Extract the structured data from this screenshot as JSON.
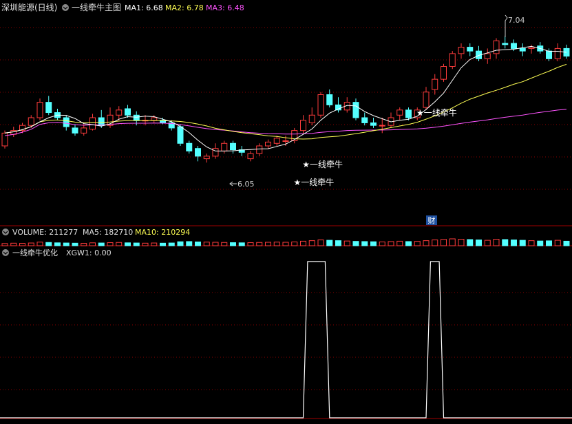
{
  "header": {
    "stock": "深圳能源(日线)",
    "indicator": "一线牵牛主图",
    "ma1": "MA1: 6.68",
    "ma2": "MA2: 6.78",
    "ma3": "MA3: 6.48"
  },
  "volume_header": {
    "volume": "VOLUME: 211277",
    "ma5": "MA5: 182710",
    "ma10": "MA10: 210294"
  },
  "sub_header": {
    "name": "一线牵牛优化",
    "xgw1": "XGW1: 0.00"
  },
  "labels": {
    "high": "7.04",
    "low": "6.05",
    "signal": "★一线牵牛",
    "cai": "财"
  },
  "colors": {
    "up": "#ff3c3c",
    "down": "#54ffff",
    "ma1": "#ffffff",
    "ma2": "#ffff54",
    "ma3": "#ff54ff",
    "grid": "#8b0000"
  },
  "chart_data": [
    {
      "type": "candlestick",
      "price_range": [
        5.6,
        7.2
      ],
      "candles": [
        [
          6.18,
          6.28,
          6.16,
          6.3
        ],
        [
          6.27,
          6.3,
          6.25,
          6.33
        ],
        [
          6.3,
          6.34,
          6.28,
          6.36
        ],
        [
          6.34,
          6.4,
          6.32,
          6.42
        ],
        [
          6.4,
          6.52,
          6.38,
          6.55
        ],
        [
          6.52,
          6.44,
          6.42,
          6.57
        ],
        [
          6.44,
          6.4,
          6.38,
          6.47
        ],
        [
          6.4,
          6.33,
          6.3,
          6.42
        ],
        [
          6.32,
          6.28,
          6.26,
          6.35
        ],
        [
          6.28,
          6.32,
          6.26,
          6.35
        ],
        [
          6.31,
          6.4,
          6.3,
          6.43
        ],
        [
          6.4,
          6.34,
          6.32,
          6.46
        ],
        [
          6.34,
          6.42,
          6.32,
          6.48
        ],
        [
          6.42,
          6.46,
          6.38,
          6.49
        ],
        [
          6.47,
          6.42,
          6.4,
          6.5
        ],
        [
          6.42,
          6.38,
          6.34,
          6.45
        ],
        [
          6.38,
          6.38,
          6.34,
          6.42
        ],
        [
          6.38,
          6.4,
          6.36,
          6.42
        ],
        [
          6.38,
          6.36,
          6.35,
          6.4
        ],
        [
          6.36,
          6.32,
          6.3,
          6.38
        ],
        [
          6.33,
          6.2,
          6.18,
          6.35
        ],
        [
          6.2,
          6.14,
          6.12,
          6.22
        ],
        [
          6.16,
          6.1,
          6.06,
          6.18
        ],
        [
          6.08,
          6.1,
          6.05,
          6.12
        ],
        [
          6.1,
          6.16,
          6.08,
          6.2
        ],
        [
          6.14,
          6.2,
          6.12,
          6.22
        ],
        [
          6.2,
          6.15,
          6.12,
          6.22
        ],
        [
          6.15,
          6.13,
          6.1,
          6.18
        ],
        [
          6.08,
          6.12,
          6.06,
          6.14
        ],
        [
          6.12,
          6.18,
          6.1,
          6.2
        ],
        [
          6.18,
          6.21,
          6.16,
          6.23
        ],
        [
          6.2,
          6.24,
          6.18,
          6.26
        ],
        [
          6.22,
          6.22,
          6.18,
          6.26
        ],
        [
          6.22,
          6.3,
          6.2,
          6.32
        ],
        [
          6.3,
          6.38,
          6.28,
          6.42
        ],
        [
          6.36,
          6.42,
          6.34,
          6.48
        ],
        [
          6.42,
          6.58,
          6.4,
          6.6
        ],
        [
          6.58,
          6.5,
          6.48,
          6.62
        ],
        [
          6.5,
          6.46,
          6.44,
          6.56
        ],
        [
          6.46,
          6.52,
          6.44,
          6.56
        ],
        [
          6.52,
          6.4,
          6.38,
          6.55
        ],
        [
          6.4,
          6.36,
          6.34,
          6.44
        ],
        [
          6.36,
          6.34,
          6.32,
          6.4
        ],
        [
          6.34,
          6.34,
          6.28,
          6.4
        ],
        [
          6.34,
          6.4,
          6.32,
          6.44
        ],
        [
          6.42,
          6.46,
          6.38,
          6.48
        ],
        [
          6.46,
          6.4,
          6.38,
          6.48
        ],
        [
          6.4,
          6.46,
          6.38,
          6.48
        ],
        [
          6.48,
          6.6,
          6.46,
          6.64
        ],
        [
          6.62,
          6.7,
          6.58,
          6.74
        ],
        [
          6.7,
          6.8,
          6.68,
          6.82
        ],
        [
          6.8,
          6.9,
          6.78,
          6.92
        ],
        [
          6.9,
          6.95,
          6.86,
          6.98
        ],
        [
          6.95,
          6.92,
          6.88,
          6.98
        ],
        [
          6.92,
          6.86,
          6.84,
          6.96
        ],
        [
          6.86,
          6.9,
          6.82,
          6.94
        ],
        [
          6.9,
          7.0,
          6.86,
          7.02
        ],
        [
          6.98,
          6.97,
          6.94,
          7.04
        ],
        [
          6.98,
          6.94,
          6.92,
          7.01
        ],
        [
          6.94,
          6.92,
          6.88,
          6.98
        ],
        [
          6.94,
          6.95,
          6.9,
          6.97
        ],
        [
          6.96,
          6.92,
          6.9,
          6.99
        ],
        [
          6.92,
          6.86,
          6.84,
          6.94
        ],
        [
          6.86,
          6.94,
          6.84,
          6.98
        ],
        [
          6.94,
          6.88,
          6.86,
          6.97
        ]
      ],
      "signals": [
        {
          "candle_index": 34,
          "row": 2
        },
        {
          "candle_index": 35,
          "row": 1
        },
        {
          "candle_index": 48,
          "row": 0
        }
      ]
    },
    {
      "type": "bar",
      "series": "volume",
      "values": [
        120,
        140,
        130,
        150,
        200,
        180,
        160,
        150,
        140,
        130,
        160,
        150,
        170,
        180,
        160,
        150,
        140,
        150,
        140,
        150,
        220,
        230,
        210,
        200,
        190,
        180,
        170,
        160,
        170,
        180,
        190,
        200,
        190,
        210,
        250,
        280,
        320,
        300,
        280,
        260,
        240,
        230,
        220,
        210,
        230,
        250,
        230,
        240,
        280,
        320,
        350,
        380,
        360,
        340,
        320,
        300,
        360,
        340,
        320,
        300,
        280,
        260,
        270,
        300,
        250
      ]
    },
    {
      "type": "line",
      "series": "XGW1",
      "ylim": [
        0,
        1
      ],
      "values": [
        0,
        0,
        0,
        0,
        0,
        0,
        0,
        0,
        0,
        0,
        0,
        0,
        0,
        0,
        0,
        0,
        0,
        0,
        0,
        0,
        0,
        0,
        0,
        0,
        0,
        0,
        0,
        0,
        0,
        0,
        0,
        0,
        0,
        0,
        0,
        1,
        1,
        0,
        0,
        0,
        0,
        0,
        0,
        0,
        0,
        0,
        0,
        0,
        0,
        1,
        0,
        0,
        0,
        0,
        0,
        0,
        0,
        0,
        0,
        0,
        0,
        0,
        0,
        0,
        0
      ]
    }
  ]
}
